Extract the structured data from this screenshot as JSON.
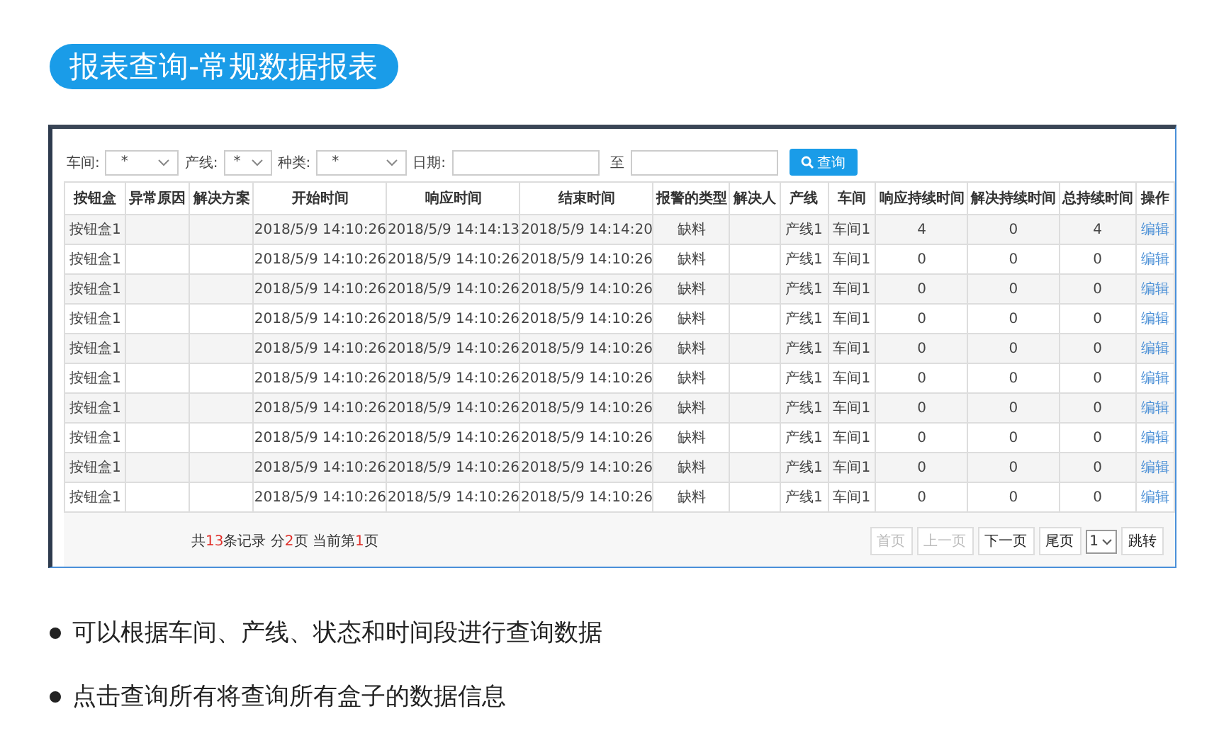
{
  "title": "报表查询-常规数据报表",
  "filters": [
    {
      "kind": "select",
      "label": "车间:",
      "value": "*"
    },
    {
      "kind": "select",
      "label": "产线:",
      "value": "*"
    },
    {
      "kind": "select",
      "label": "种类:",
      "value": "*"
    },
    {
      "kind": "date",
      "label": "日期:"
    },
    {
      "kind": "date",
      "label": "至"
    }
  ],
  "search_button": "查询",
  "table": {
    "columns": [
      "按钮盒",
      "异常原因",
      "解决方案",
      "开始时间",
      "响应时间",
      "结束时间",
      "报警的类型",
      "解决人",
      "产线",
      "车间",
      "响应持续时间",
      "解决持续时间",
      "总持续时间",
      "操作"
    ],
    "rows": [
      [
        "按钮盒1",
        "",
        "",
        "2018/5/9 14:10:26",
        "2018/5/9 14:14:13",
        "2018/5/9 14:14:20",
        "缺料",
        "",
        "产线1",
        "车间1",
        "4",
        "0",
        "4",
        "编辑"
      ],
      [
        "按钮盒1",
        "",
        "",
        "2018/5/9 14:10:26",
        "2018/5/9 14:10:26",
        "2018/5/9 14:10:26",
        "缺料",
        "",
        "产线1",
        "车间1",
        "0",
        "0",
        "0",
        "编辑"
      ],
      [
        "按钮盒1",
        "",
        "",
        "2018/5/9 14:10:26",
        "2018/5/9 14:10:26",
        "2018/5/9 14:10:26",
        "缺料",
        "",
        "产线1",
        "车间1",
        "0",
        "0",
        "0",
        "编辑"
      ],
      [
        "按钮盒1",
        "",
        "",
        "2018/5/9 14:10:26",
        "2018/5/9 14:10:26",
        "2018/5/9 14:10:26",
        "缺料",
        "",
        "产线1",
        "车间1",
        "0",
        "0",
        "0",
        "编辑"
      ],
      [
        "按钮盒1",
        "",
        "",
        "2018/5/9 14:10:26",
        "2018/5/9 14:10:26",
        "2018/5/9 14:10:26",
        "缺料",
        "",
        "产线1",
        "车间1",
        "0",
        "0",
        "0",
        "编辑"
      ],
      [
        "按钮盒1",
        "",
        "",
        "2018/5/9 14:10:26",
        "2018/5/9 14:10:26",
        "2018/5/9 14:10:26",
        "缺料",
        "",
        "产线1",
        "车间1",
        "0",
        "0",
        "0",
        "编辑"
      ],
      [
        "按钮盒1",
        "",
        "",
        "2018/5/9 14:10:26",
        "2018/5/9 14:10:26",
        "2018/5/9 14:10:26",
        "缺料",
        "",
        "产线1",
        "车间1",
        "0",
        "0",
        "0",
        "编辑"
      ],
      [
        "按钮盒1",
        "",
        "",
        "2018/5/9 14:10:26",
        "2018/5/9 14:10:26",
        "2018/5/9 14:10:26",
        "缺料",
        "",
        "产线1",
        "车间1",
        "0",
        "0",
        "0",
        "编辑"
      ],
      [
        "按钮盒1",
        "",
        "",
        "2018/5/9 14:10:26",
        "2018/5/9 14:10:26",
        "2018/5/9 14:10:26",
        "缺料",
        "",
        "产线1",
        "车间1",
        "0",
        "0",
        "0",
        "编辑"
      ],
      [
        "按钮盒1",
        "",
        "",
        "2018/5/9 14:10:26",
        "2018/5/9 14:10:26",
        "2018/5/9 14:10:26",
        "缺料",
        "",
        "产线1",
        "车间1",
        "0",
        "0",
        "0",
        "编辑"
      ]
    ]
  },
  "pager": {
    "info": "共**13**条记录 分**2**页 当前第**1**页",
    "buttons": [
      {
        "label": "首页",
        "disabled": true
      },
      {
        "label": "上一页",
        "disabled": true
      },
      {
        "label": "下一页",
        "disabled": false
      },
      {
        "label": "尾页",
        "disabled": false
      }
    ],
    "page_select": "1",
    "go_button": "跳转"
  },
  "bullets": [
    "可以根据车间、产线、状态和时间段进行查询数据",
    "点击查询所有将查询所有盒子的数据信息"
  ]
}
